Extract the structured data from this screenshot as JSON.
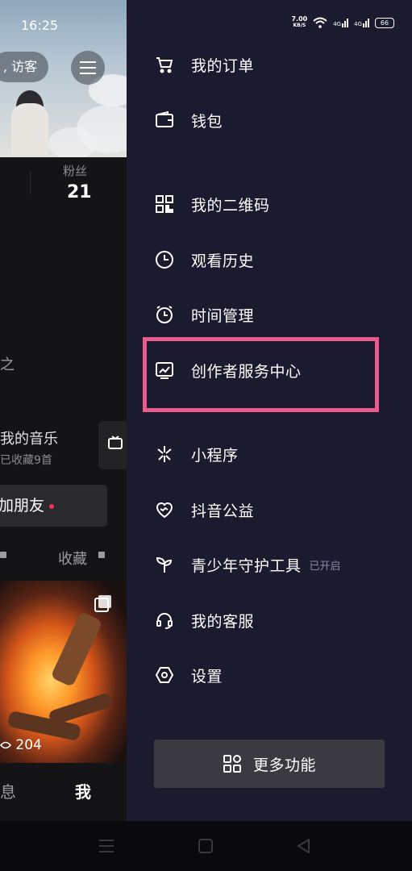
{
  "status_bar": {
    "time": "16:25",
    "net_speed_value": "7.00",
    "net_speed_unit": "KB/S",
    "signal_1": "4G",
    "signal_2": "4G",
    "battery": "66"
  },
  "background_page": {
    "visitor_label": ", 访客",
    "fans_label": "粉丝",
    "fans_count": "21",
    "fragment_row": "之",
    "music_title": "我的音乐",
    "music_sub": "已收藏9首",
    "add_friend_label": "加朋友",
    "favorites_tab": "收藏",
    "views_count": "204",
    "tab_messages": "息",
    "tab_me": "我"
  },
  "drawer": {
    "items": [
      {
        "label": "我的订单",
        "icon": "cart-icon"
      },
      {
        "label": "钱包",
        "icon": "wallet-icon"
      },
      {
        "label": "我的二维码",
        "icon": "qrcode-icon"
      },
      {
        "label": "观看历史",
        "icon": "clock-icon"
      },
      {
        "label": "时间管理",
        "icon": "alarm-icon"
      },
      {
        "label": "创作者服务中心",
        "icon": "chart-monitor-icon"
      },
      {
        "label": "小程序",
        "icon": "mini-program-icon"
      },
      {
        "label": "抖音公益",
        "icon": "charity-heart-icon"
      },
      {
        "label": "青少年守护工具",
        "icon": "sprout-icon",
        "badge": "已开启"
      },
      {
        "label": "我的客服",
        "icon": "headset-icon"
      },
      {
        "label": "设置",
        "icon": "settings-hex-icon"
      }
    ],
    "more_label": "更多功能"
  },
  "colors": {
    "drawer_bg": "#1b1a2e",
    "highlight": "#ea5c8e",
    "accent_red": "#fe2c55"
  }
}
